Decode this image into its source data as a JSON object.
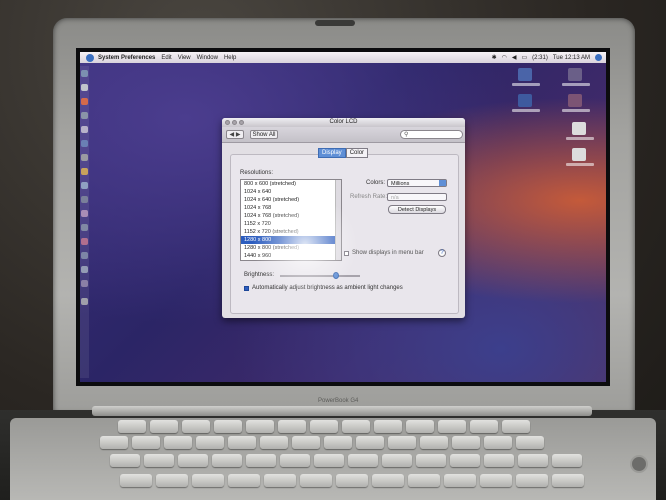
{
  "menubar": {
    "app": "System Preferences",
    "items": [
      "Edit",
      "View",
      "Window",
      "Help"
    ],
    "battery": "(2:31)",
    "clock": "Tue 12:13 AM"
  },
  "window": {
    "title": "Color LCD",
    "show_all": "Show All",
    "tabs": [
      "Display",
      "Color"
    ],
    "active_tab": "Display",
    "resolutions_label": "Resolutions:",
    "resolutions": [
      "800 x 600 (stretched)",
      "1024 x 640",
      "1024 x 640 (stretched)",
      "1024 x 768",
      "1024 x 768 (stretched)",
      "1152 x 720",
      "1152 x 720 (stretched)",
      "1280 x 800",
      "1280 x 800 (stretched)",
      "1440 x 960"
    ],
    "selected_resolution": "1280 x 800",
    "colors_label": "Colors:",
    "colors_value": "Millions",
    "refresh_label": "Refresh Rate:",
    "refresh_value": "n/a",
    "detect_button": "Detect Displays",
    "menubar_checkbox": "Show displays in menu bar",
    "menubar_checked": false,
    "help": "?",
    "brightness_label": "Brightness:",
    "brightness_level": 0.72,
    "auto_brightness": "Automatically adjust brightness as ambient light changes",
    "auto_checked": true
  },
  "laptop": {
    "model": "PowerBook G4"
  },
  "colors": {
    "selection": "#2c5dbf",
    "accent": "#5f8fd6"
  }
}
